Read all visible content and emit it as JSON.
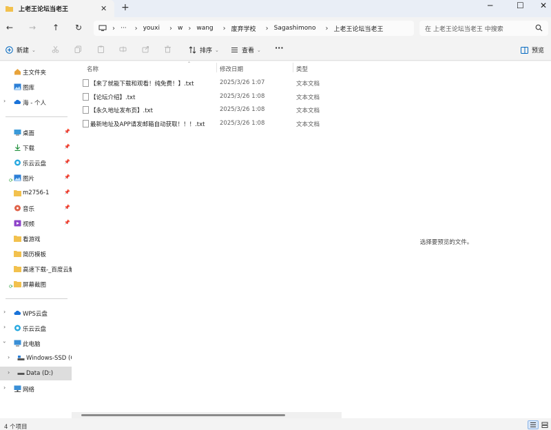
{
  "window": {
    "tab_title": "上老王论坛当老王",
    "tab_close": "✕",
    "new_tab": "+",
    "controls": {
      "minimize": "─",
      "maximize": "☐",
      "close": "✕"
    }
  },
  "nav": {
    "back": "←",
    "forward": "→",
    "up": "↑",
    "refresh": "↻",
    "overflow": "···"
  },
  "address": {
    "crumbs": [
      "youxi",
      "w",
      "wang",
      "废弃学校",
      "Sagashimono",
      "上老王论坛当老王"
    ]
  },
  "search": {
    "placeholder": "在 上老王论坛当老王 中搜索"
  },
  "toolbar": {
    "new_label": "新建",
    "sort_label": "排序",
    "view_label": "查看",
    "more_label": "···",
    "preview_label": "预览"
  },
  "sidebar": {
    "items": [
      {
        "label": "主文件夹",
        "icon": "home-icon"
      },
      {
        "label": "图库",
        "icon": "gallery-icon"
      },
      {
        "label": "海 - 个人",
        "icon": "cloud-icon"
      },
      {
        "label": "桌面",
        "icon": "desktop-icon",
        "pinned": true
      },
      {
        "label": "下载",
        "icon": "download-icon",
        "pinned": true
      },
      {
        "label": "乐云云盘",
        "icon": "cloud-drive-icon",
        "pinned": true
      },
      {
        "label": "图片",
        "icon": "pictures-icon",
        "pinned": true
      },
      {
        "label": "m2756-1",
        "icon": "folder-icon",
        "pinned": true
      },
      {
        "label": "音乐",
        "icon": "music-icon",
        "pinned": true
      },
      {
        "label": "视频",
        "icon": "video-icon",
        "pinned": true
      },
      {
        "label": "看游戏",
        "icon": "folder-icon"
      },
      {
        "label": "简历模板",
        "icon": "folder-icon"
      },
      {
        "label": "高速下载-_百度云解",
        "icon": "folder-icon"
      },
      {
        "label": "屏幕截图",
        "icon": "folder-icon"
      },
      {
        "label": "WPS云盘",
        "icon": "cloud-icon"
      },
      {
        "label": "乐云云盘",
        "icon": "cloud-drive-icon"
      },
      {
        "label": "此电脑",
        "icon": "pc-icon"
      },
      {
        "label": "Windows-SSD (C",
        "icon": "drive-icon"
      },
      {
        "label": "Data (D:)",
        "icon": "drive-icon"
      },
      {
        "label": "网络",
        "icon": "network-icon"
      }
    ],
    "pin_glyph": "📌"
  },
  "columns": {
    "name": "名称",
    "date": "修改日期",
    "type": "类型"
  },
  "files": [
    {
      "name": "【来了就能下载和观看！纯免费！】.txt",
      "date": "2025/3/26 1:07",
      "type": "文本文档"
    },
    {
      "name": "【论坛介绍】.txt",
      "date": "2025/3/26 1:08",
      "type": "文本文档"
    },
    {
      "name": "【永久地址发布页】.txt",
      "date": "2025/3/26 1:08",
      "type": "文本文档"
    },
    {
      "name": "最新地址及APP请发邮箱自动获取！！！.txt",
      "date": "2025/3/26 1:08",
      "type": "文本文档"
    }
  ],
  "preview": {
    "message": "选择要预览的文件。"
  },
  "status": {
    "count": "4 个项目"
  },
  "colors": {
    "accent": "#0067c0",
    "folder": "#f2c14e",
    "selected": "#dddddd"
  }
}
